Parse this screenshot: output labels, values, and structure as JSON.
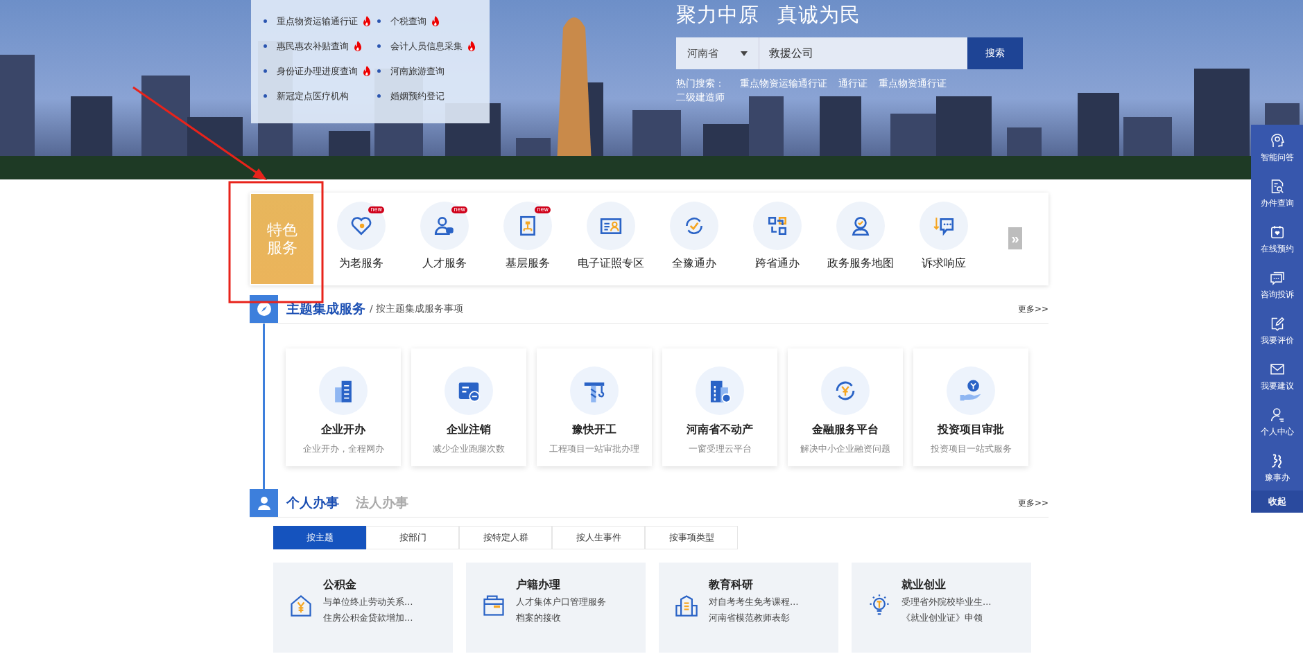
{
  "hot_services": {
    "items": [
      {
        "label": "重点物资运输通行证",
        "hot": true
      },
      {
        "label": "个税查询",
        "hot": true
      },
      {
        "label": "惠民惠农补贴查询",
        "hot": true
      },
      {
        "label": "会计人员信息采集",
        "hot": true
      },
      {
        "label": "身份证办理进度查询",
        "hot": true
      },
      {
        "label": "河南旅游查询",
        "hot": false
      },
      {
        "label": "新冠定点医疗机构",
        "hot": false
      },
      {
        "label": "婚姻预约登记",
        "hot": false
      }
    ]
  },
  "slogan": [
    "聚力中原",
    "真诚为民"
  ],
  "search": {
    "region": "河南省",
    "value": "救援公司",
    "button": "搜索",
    "hot_label": "热门搜索：",
    "hot_terms": [
      "重点物资运输通行证",
      "通行证",
      "重点物资通行证",
      "二级建造师"
    ]
  },
  "special_services": {
    "title": "特色服务",
    "next_button": "»",
    "items": [
      {
        "label": "为老服务",
        "badge": "new"
      },
      {
        "label": "人才服务",
        "badge": "new"
      },
      {
        "label": "基层服务",
        "badge": "new"
      },
      {
        "label": "电子证照专区"
      },
      {
        "label": "全豫通办"
      },
      {
        "label": "跨省通办"
      },
      {
        "label": "政务服务地图"
      },
      {
        "label": "诉求响应"
      }
    ]
  },
  "theme_section": {
    "title": "主题集成服务",
    "subtitle": "/ 按主题集成服务事项",
    "more": "更多>>",
    "cards": [
      {
        "title": "企业开办",
        "desc": "企业开办，全程网办"
      },
      {
        "title": "企业注销",
        "desc": "减少企业跑腿次数"
      },
      {
        "title": "豫快开工",
        "desc": "工程项目一站审批办理"
      },
      {
        "title": "河南省不动产",
        "desc": "一窗受理云平台"
      },
      {
        "title": "金融服务平台",
        "desc": "解决中小企业融资问题"
      },
      {
        "title": "投资项目审批",
        "desc": "投资项目一站式服务"
      }
    ]
  },
  "affairs_section": {
    "more": "更多>>",
    "tabs": [
      {
        "label": "个人办事",
        "selected": true
      },
      {
        "label": "法人办事",
        "selected": false
      }
    ],
    "filters": [
      {
        "label": "按主题",
        "selected": true
      },
      {
        "label": "按部门",
        "selected": false
      },
      {
        "label": "按特定人群",
        "selected": false
      },
      {
        "label": "按人生事件",
        "selected": false
      },
      {
        "label": "按事项类型",
        "selected": false
      }
    ],
    "cards": [
      {
        "title": "公积金",
        "lines": [
          "与单位终止劳动关系…",
          "住房公积金贷款增加…"
        ]
      },
      {
        "title": "户籍办理",
        "lines": [
          "人才集体户口管理服务",
          "档案的接收"
        ]
      },
      {
        "title": "教育科研",
        "lines": [
          "对自考考生免考课程…",
          "河南省模范教师表彰"
        ]
      },
      {
        "title": "就业创业",
        "lines": [
          "受理省外院校毕业生…",
          "《就业创业证》申领"
        ]
      }
    ]
  },
  "side_bar": {
    "items": [
      "智能问答",
      "办件查询",
      "在线预约",
      "咨询投诉",
      "我要评价",
      "我要建议",
      "个人中心",
      "豫事办"
    ],
    "collapse": "收起"
  }
}
